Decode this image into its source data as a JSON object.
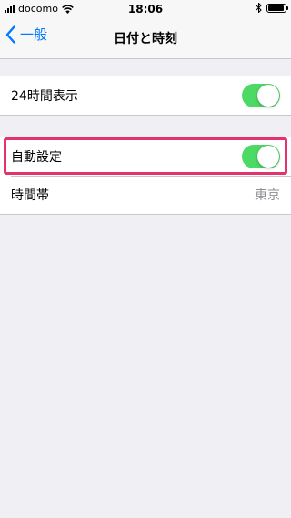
{
  "status_bar": {
    "carrier": "docomo",
    "time": "18:06"
  },
  "nav": {
    "back_label": "一般",
    "title": "日付と時刻"
  },
  "settings": {
    "time24": {
      "label": "24時間表示",
      "on": true
    },
    "auto_set": {
      "label": "自動設定",
      "on": true
    },
    "timezone": {
      "label": "時間帯",
      "value": "東京"
    }
  },
  "colors": {
    "accent": "#007aff",
    "toggle_on": "#4cd964",
    "highlight": "#e6326a",
    "background": "#efeff4"
  },
  "icons": {
    "back": "chevron-left-icon",
    "wifi": "wifi-icon",
    "bluetooth": "bluetooth-icon",
    "battery": "battery-icon",
    "signal": "signal-icon"
  }
}
